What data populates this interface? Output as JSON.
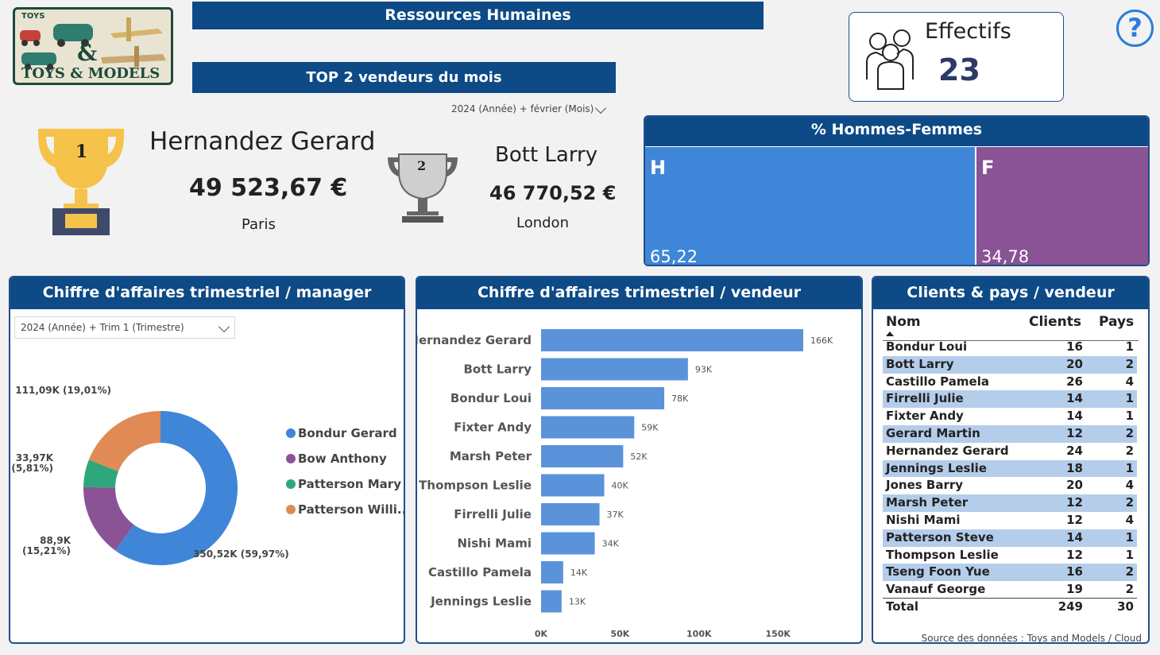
{
  "logo": {
    "top_text": "TOYS",
    "amp": "&",
    "bottom_text": "TOYS & MODELS"
  },
  "header": {
    "title": "Ressources Humaines",
    "subtitle": "TOP 2 vendeurs du mois"
  },
  "month_slicer": {
    "value": "2024 (Année) + février (Mois)"
  },
  "effectifs": {
    "label": "Effectifs",
    "value": "23"
  },
  "help": {
    "glyph": "?"
  },
  "top1": {
    "rank": "1",
    "name": "Hernandez Gerard",
    "amount": "49 523,67 €",
    "city": "Paris"
  },
  "top2": {
    "rank": "2",
    "name": "Bott Larry",
    "amount": "46 770,52 €",
    "city": "London"
  },
  "gender": {
    "title": "% Hommes-Femmes",
    "male_label": "H",
    "male_value": "65,22",
    "male_pct": 65.22,
    "female_label": "F",
    "female_value": "34,78",
    "female_pct": 34.78,
    "colors": {
      "male": "#3f86d8",
      "female": "#8a5396"
    }
  },
  "manager_panel": {
    "title": "Chiffre d'affaires trimestriel / manager",
    "slicer": "2024 (Année) + Trim 1 (Trimestre)"
  },
  "seller_panel": {
    "title": "Chiffre d'affaires trimestriel / vendeur"
  },
  "clients_panel": {
    "title": "Clients & pays / vendeur",
    "columns": [
      "Nom",
      "Clients",
      "Pays"
    ],
    "rows": [
      [
        "Bondur Loui",
        "16",
        "1"
      ],
      [
        "Bott Larry",
        "20",
        "2"
      ],
      [
        "Castillo Pamela",
        "26",
        "4"
      ],
      [
        "Firrelli Julie",
        "14",
        "1"
      ],
      [
        "Fixter Andy",
        "14",
        "1"
      ],
      [
        "Gerard Martin",
        "12",
        "2"
      ],
      [
        "Hernandez Gerard",
        "24",
        "2"
      ],
      [
        "Jennings Leslie",
        "18",
        "1"
      ],
      [
        "Jones Barry",
        "20",
        "4"
      ],
      [
        "Marsh Peter",
        "12",
        "2"
      ],
      [
        "Nishi Mami",
        "12",
        "4"
      ],
      [
        "Patterson Steve",
        "14",
        "1"
      ],
      [
        "Thompson Leslie",
        "12",
        "1"
      ],
      [
        "Tseng Foon Yue",
        "16",
        "2"
      ],
      [
        "Vanauf George",
        "19",
        "2"
      ]
    ],
    "total": [
      "Total",
      "249",
      "30"
    ]
  },
  "source": "Source des données : Toys and Models / Cloud",
  "chart_data": [
    {
      "type": "pie",
      "variant": "donut",
      "categories": [
        "Bondur Gerard",
        "Bow Anthony",
        "Patterson Mary",
        "Patterson Willi..."
      ],
      "values": [
        350.52,
        88.9,
        33.97,
        111.09
      ],
      "percents": [
        59.97,
        15.21,
        5.81,
        19.01
      ],
      "data_labels": [
        "350,52K (59,97%)",
        "88,9K (15,21%)",
        "33,97K (5,81%)",
        "111,09K (19,01%)"
      ],
      "colors": [
        "#3f86d8",
        "#8a5396",
        "#2ea87a",
        "#e08a55"
      ],
      "legend": "right"
    },
    {
      "type": "bar",
      "orientation": "horizontal",
      "categories": [
        "Hernandez Gerard",
        "Bott Larry",
        "Bondur Loui",
        "Fixter Andy",
        "Marsh Peter",
        "Thompson Leslie",
        "Firrelli Julie",
        "Nishi Mami",
        "Castillo Pamela",
        "Jennings Leslie"
      ],
      "values": [
        166,
        93,
        78,
        59,
        52,
        40,
        37,
        34,
        14,
        13
      ],
      "data_labels": [
        "166K",
        "93K",
        "78K",
        "59K",
        "52K",
        "40K",
        "37K",
        "34K",
        "14K",
        "13K"
      ],
      "xticks": [
        "0K",
        "50K",
        "100K",
        "150K"
      ],
      "xlim": [
        0,
        166
      ],
      "color": "#5b93db"
    }
  ]
}
